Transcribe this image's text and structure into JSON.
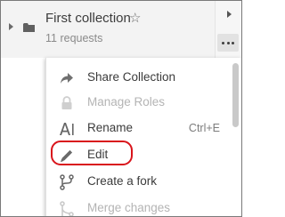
{
  "collection": {
    "name": "First collection",
    "count_text": "11 requests",
    "icons": {
      "expand": "expand-caret-icon",
      "folder": "folder-icon",
      "star": "star-icon",
      "more": "more-options-icon"
    }
  },
  "menu": {
    "items": [
      {
        "label": "Share Collection",
        "shortcut": "",
        "icon": "share-arrow-icon",
        "disabled": false
      },
      {
        "label": "Manage Roles",
        "shortcut": "",
        "icon": "lock-icon",
        "disabled": true
      },
      {
        "label": "Rename",
        "shortcut": "Ctrl+E",
        "icon": "rename-text-icon",
        "disabled": false
      },
      {
        "label": "Edit",
        "shortcut": "",
        "icon": "pencil-icon",
        "disabled": false
      },
      {
        "label": "Create a fork",
        "shortcut": "",
        "icon": "fork-icon",
        "disabled": false
      },
      {
        "label": "Merge changes",
        "shortcut": "",
        "icon": "merge-icon",
        "disabled": true
      }
    ]
  },
  "colors": {
    "highlight": "#d9141b",
    "header_bg": "#f3f3f3"
  }
}
